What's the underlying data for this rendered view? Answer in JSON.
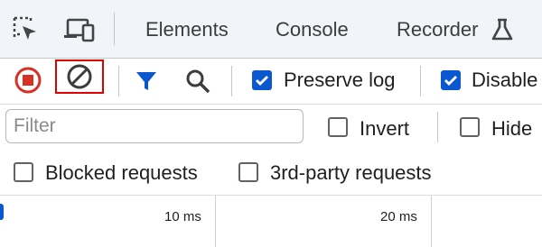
{
  "top_tabs": [
    {
      "label": "Elements"
    },
    {
      "label": "Console"
    },
    {
      "label": "Recorder"
    }
  ],
  "toolbar": {
    "preserve_log": {
      "label": "Preserve log",
      "checked": true
    },
    "disable_cache": {
      "label": "Disable",
      "checked": true
    }
  },
  "filter_row": {
    "filter_placeholder": "Filter",
    "invert": {
      "label": "Invert",
      "checked": false
    },
    "hide": {
      "label": "Hide",
      "checked": false
    }
  },
  "request_filters": {
    "blocked": {
      "label": "Blocked requests",
      "checked": false
    },
    "third_party": {
      "label": "3rd-party requests",
      "checked": false
    }
  },
  "timeline": {
    "ticks": [
      "10 ms",
      "20 ms"
    ]
  },
  "colors": {
    "accent_blue": "#0b57d0",
    "record_red": "#d93025",
    "highlight_red": "#e00000"
  },
  "icons": [
    "select-element-icon",
    "device-toolbar-icon",
    "flask-icon",
    "stop-recording-icon",
    "clear-icon",
    "filter-icon",
    "search-icon"
  ]
}
